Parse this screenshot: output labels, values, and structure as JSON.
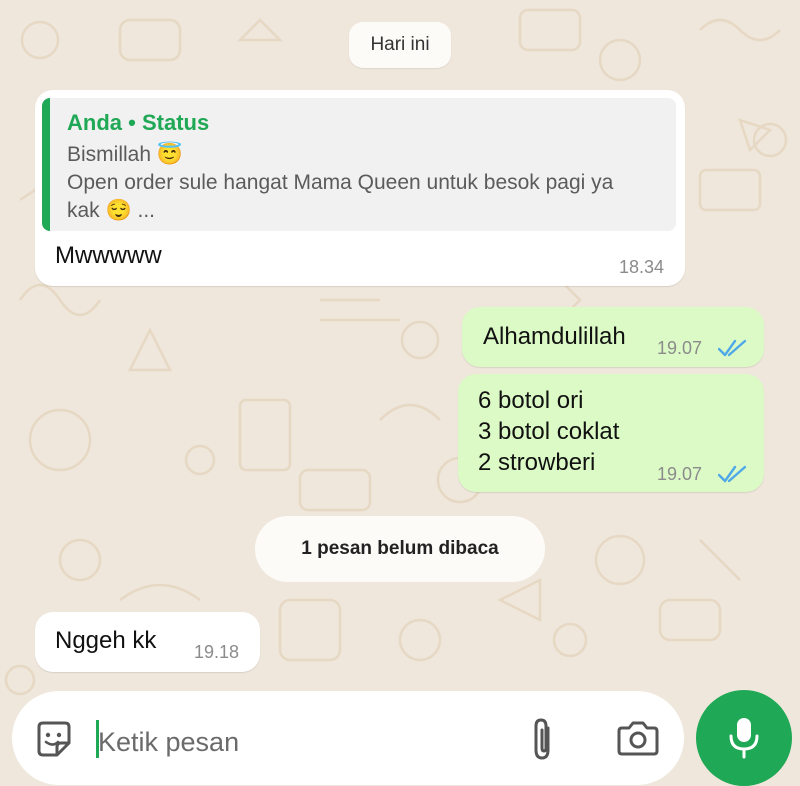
{
  "date_separator": "Hari ini",
  "messages": [
    {
      "direction": "incoming",
      "quote": {
        "author": "Anda",
        "separator": "•",
        "source": "Status",
        "lines": [
          "Bismillah 😇",
          "Open order sule hangat Mama Queen untuk besok pagi ya",
          "kak 😌 ..."
        ]
      },
      "text": "Mwwwww",
      "time": "18.34"
    },
    {
      "direction": "outgoing",
      "text": "Alhamdulillah",
      "time": "19.07",
      "status": "read"
    },
    {
      "direction": "outgoing",
      "lines": [
        "6 botol ori",
        "3 botol coklat",
        "2 strowberi"
      ],
      "time": "19.07",
      "status": "read"
    }
  ],
  "unread_separator": "1 pesan belum dibaca",
  "unread_messages": [
    {
      "direction": "incoming",
      "text": "Nggeh kk",
      "time": "19.18"
    }
  ],
  "composer": {
    "placeholder": "Ketik pesan",
    "icons": [
      "sticker-icon",
      "attach-icon",
      "camera-icon",
      "mic-icon"
    ]
  },
  "colors": {
    "accent": "#1fa855",
    "outgoing_bubble": "#dcfac6",
    "incoming_bubble": "#ffffff",
    "read_ticks": "#4fa9e8",
    "wallpaper": "#efe7dc"
  }
}
